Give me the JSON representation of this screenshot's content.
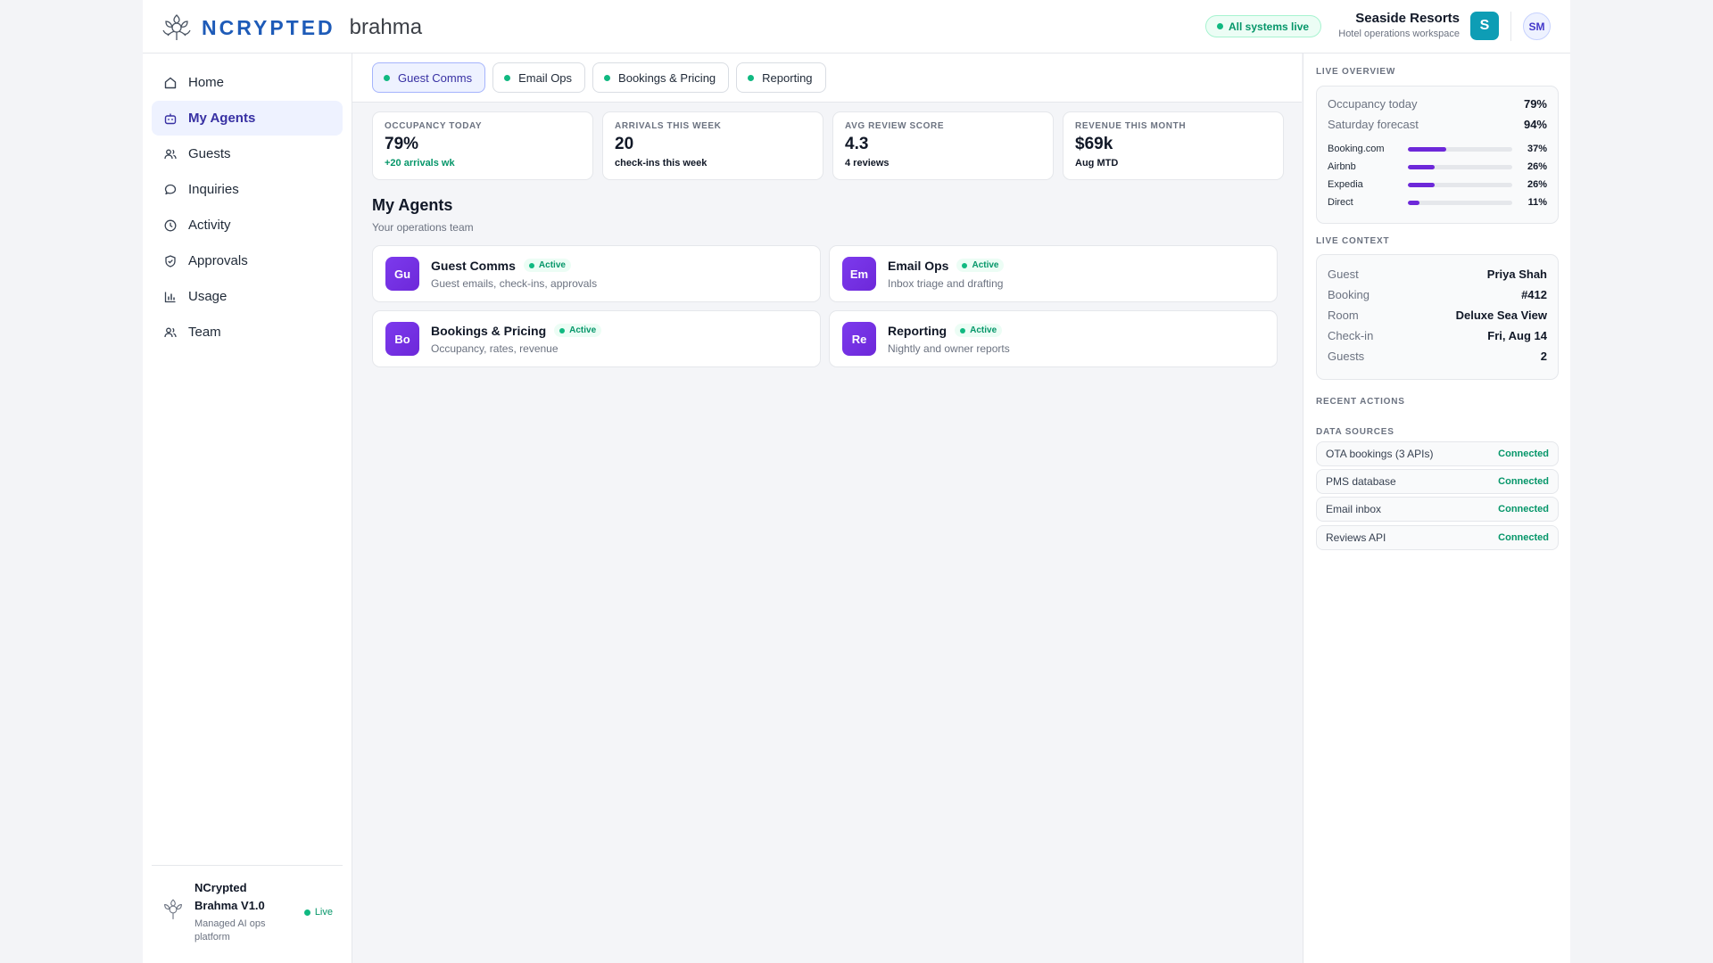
{
  "header": {
    "brand_name": "NCRYPTED",
    "product_name": "brahma",
    "system_status": "All systems live",
    "workspace_name": "Seaside Resorts",
    "workspace_sub": "Hotel operations workspace",
    "workspace_initial": "S",
    "user_initials": "SM"
  },
  "sidebar": {
    "items": [
      {
        "label": "Home",
        "icon": "home-icon"
      },
      {
        "label": "My Agents",
        "icon": "agents-icon"
      },
      {
        "label": "Guests",
        "icon": "guests-icon"
      },
      {
        "label": "Inquiries",
        "icon": "chat-icon"
      },
      {
        "label": "Activity",
        "icon": "clock-icon"
      },
      {
        "label": "Approvals",
        "icon": "shield-check-icon"
      },
      {
        "label": "Usage",
        "icon": "bar-chart-icon"
      },
      {
        "label": "Team",
        "icon": "team-icon"
      }
    ],
    "active_index": 1,
    "footer": {
      "title": "NCrypted Brahma V1.0",
      "subtitle": "Managed AI ops platform",
      "status": "Live"
    }
  },
  "tabs": [
    {
      "label": "Guest Comms"
    },
    {
      "label": "Email Ops"
    },
    {
      "label": "Bookings & Pricing"
    },
    {
      "label": "Reporting"
    }
  ],
  "stats": [
    {
      "label": "OCCUPANCY TODAY",
      "value": "79%",
      "sub": "+20 arrivals wk",
      "sub_positive": true
    },
    {
      "label": "ARRIVALS THIS WEEK",
      "value": "20",
      "sub": "check-ins this week"
    },
    {
      "label": "AVG REVIEW SCORE",
      "value": "4.3",
      "sub": "4 reviews"
    },
    {
      "label": "REVENUE THIS MONTH",
      "value": "$69k",
      "sub": "Aug MTD"
    }
  ],
  "agents_section": {
    "title": "My Agents",
    "subtitle": "Your operations team",
    "agents": [
      {
        "initials": "Gu",
        "name": "Guest Comms",
        "status": "Active",
        "desc": "Guest emails, check-ins, approvals"
      },
      {
        "initials": "Em",
        "name": "Email Ops",
        "status": "Active",
        "desc": "Inbox triage and drafting"
      },
      {
        "initials": "Bo",
        "name": "Bookings & Pricing",
        "status": "Active",
        "desc": "Occupancy, rates, revenue"
      },
      {
        "initials": "Re",
        "name": "Reporting",
        "status": "Active",
        "desc": "Nightly and owner reports"
      }
    ]
  },
  "right_panel": {
    "live_overview": {
      "label": "LIVE OVERVIEW",
      "rows": [
        {
          "k": "Occupancy today",
          "v": "79%"
        },
        {
          "k": "Saturday forecast",
          "v": "94%"
        }
      ],
      "channels": [
        {
          "name": "Booking.com",
          "value": "37%",
          "pct": 37
        },
        {
          "name": "Airbnb",
          "value": "26%",
          "pct": 26
        },
        {
          "name": "Expedia",
          "value": "26%",
          "pct": 26
        },
        {
          "name": "Direct",
          "value": "11%",
          "pct": 11
        }
      ]
    },
    "live_context": {
      "label": "LIVE CONTEXT",
      "rows": [
        {
          "k": "Guest",
          "v": "Priya Shah"
        },
        {
          "k": "Booking",
          "v": "#412"
        },
        {
          "k": "Room",
          "v": "Deluxe Sea View"
        },
        {
          "k": "Check-in",
          "v": "Fri, Aug 14"
        },
        {
          "k": "Guests",
          "v": "2"
        }
      ]
    },
    "recent_actions_label": "RECENT ACTIONS",
    "data_sources": {
      "label": "DATA SOURCES",
      "items": [
        {
          "name": "OTA bookings (3 APIs)",
          "status": "Connected"
        },
        {
          "name": "PMS database",
          "status": "Connected"
        },
        {
          "name": "Email inbox",
          "status": "Connected"
        },
        {
          "name": "Reviews API",
          "status": "Connected"
        }
      ]
    }
  },
  "colors": {
    "accent": "#3730a3",
    "brand": "#1e5bb8",
    "agent_avatar": "#6d28d9",
    "success": "#059669",
    "workspace_badge": "#0e9db5"
  }
}
